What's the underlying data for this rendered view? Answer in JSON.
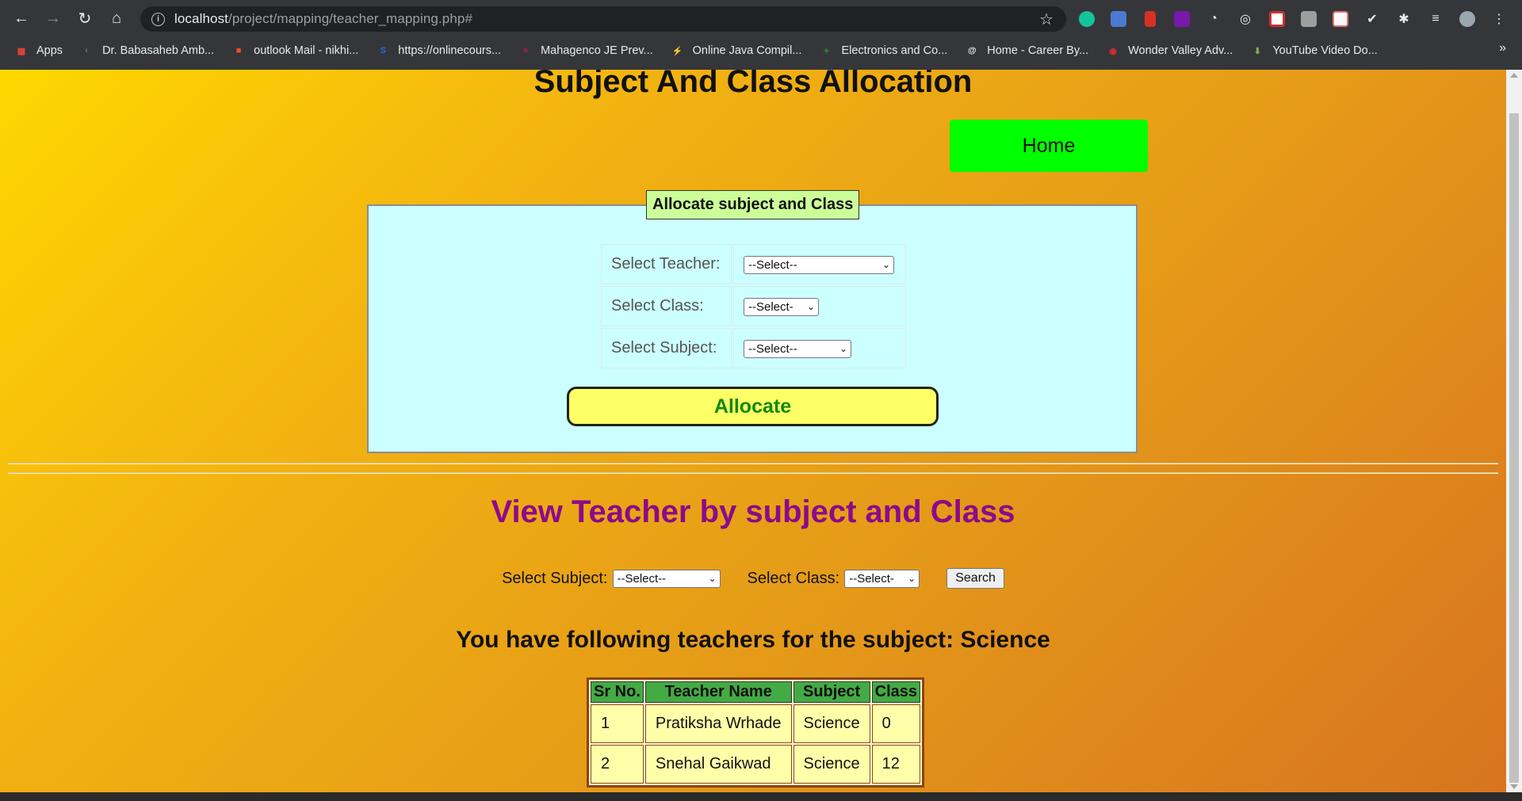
{
  "browser": {
    "url_host": "localhost",
    "url_path": "/project/mapping/teacher_mapping.php#",
    "bookmarks": [
      {
        "label": "Apps",
        "color": "#ea4335",
        "glyph": "▦"
      },
      {
        "label": "Dr. Babasaheb Amb...",
        "color": "#5f6368",
        "glyph": "◐"
      },
      {
        "label": "outlook Mail - nikhi...",
        "color": "#f25022",
        "glyph": "■"
      },
      {
        "label": "https://onlinecours...",
        "color": "#1a73e8",
        "glyph": "S"
      },
      {
        "label": "Mahagenco JE Prev...",
        "color": "#c2185b",
        "glyph": "≈"
      },
      {
        "label": "Online Java Compil...",
        "color": "#7b3fe4",
        "glyph": "⚡"
      },
      {
        "label": "Electronics and Co...",
        "color": "#2e7d32",
        "glyph": "✦"
      },
      {
        "label": "Home - Career By...",
        "color": "#e8eaed",
        "glyph": "@"
      },
      {
        "label": "Wonder Valley Adv...",
        "color": "#d32f2f",
        "glyph": "◉"
      },
      {
        "label": "YouTube Video Do...",
        "color": "#7cb342",
        "glyph": "⬇"
      }
    ]
  },
  "page": {
    "title": "Subject And Class Allocation",
    "home_label": "Home",
    "allocate_form": {
      "legend": "Allocate subject and Class",
      "teacher_label": "Select Teacher:",
      "teacher_value": "--Select--",
      "class_label": "Select Class:",
      "class_value": "--Select-",
      "subject_label": "Select Subject:",
      "subject_value": "--Select--",
      "allocate_label": "Allocate"
    },
    "view": {
      "title": "View Teacher by subject and Class",
      "subject_label": "Select Subject:",
      "subject_value": "--Select--",
      "class_label": "Select Class:",
      "class_value": "--Select-",
      "search_label": "Search"
    },
    "results": {
      "heading": "You have following teachers for the subject: Science",
      "columns": [
        "Sr No.",
        "Teacher Name",
        "Subject",
        "Class"
      ],
      "rows": [
        [
          "1",
          "Pratiksha Wrhade",
          "Science",
          "0"
        ],
        [
          "2",
          "Snehal Gaikwad",
          "Science",
          "12"
        ]
      ]
    }
  }
}
